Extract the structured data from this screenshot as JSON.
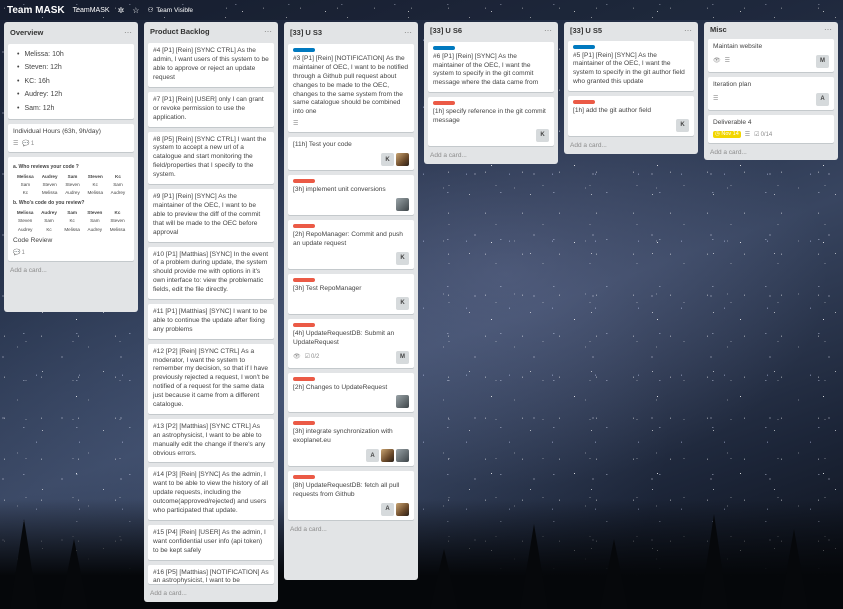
{
  "header": {
    "board_title": "Team MASK",
    "org_name": "TeamMASK",
    "visibility_label": "Team Visible",
    "star_icon": "star-icon",
    "org_icon": "org-gear-icon",
    "visibility_icon": "team-icon"
  },
  "colors": {
    "label_blue": "#0079bf",
    "label_red": "#eb5a46",
    "due_yellow": "#f2d600",
    "list_bg": "#e2e4e6"
  },
  "add_card_label": "Add a card...",
  "lists": {
    "overview": {
      "title": "Overview",
      "bullets": [
        "Melissa: 10h",
        "Steven: 12h",
        "KC: 16h",
        "Audrey: 12h",
        "Sam: 12h"
      ],
      "hours_card": {
        "title": "Individual Hours (63h, 9h/day)",
        "comments": "1"
      },
      "review_title": "a. Who reviews your code ?",
      "review_rows": [
        [
          "Melissa",
          "Audrey",
          "Sam",
          "Steven",
          "Kc"
        ],
        [
          "Sam",
          "Steven",
          "Steven",
          "Kc",
          "Sam"
        ],
        [
          "Kc",
          "Melissa",
          "Audrey",
          "Melissa",
          "Audrey"
        ]
      ],
      "who_review_title": "b. Who's code do you review?",
      "who_rows": [
        [
          "Melissa",
          "Audrey",
          "Sam",
          "Steven",
          "Kc"
        ],
        [
          "Steven",
          "Sam",
          "Kc",
          "Sam",
          "Steven"
        ],
        [
          "Audrey",
          "Kc",
          "Melissa",
          "Audrey",
          "Melissa"
        ]
      ],
      "code_review": {
        "title": "Code Review",
        "comments": "1"
      }
    },
    "backlog": {
      "title": "Product Backlog",
      "cards": [
        "#4 [P1] [Rein] [SYNC CTRL] As the admin, I want users of this system to be able to approve or reject an update request",
        "#7 [P1] [Rein] [USER] only I can grant or revoke permission to use the application.",
        "#8 [P5] [Rein] [SYNC CTRL] I want the system to accept a new url of a catalogue and start monitoring the field/properties that I specify to the system.",
        "#9 [P1] [Rein] [SYNC] As the maintainer of the OEC, I want to be able to preview the diff of the commit that will be made to the OEC before approval",
        "#10 [P1] [Matthias] [SYNC] In the event of a problem during update, the system should provide me with options in it's own interface to: view the problematic fields, edit the file directly.",
        "#11 [P1] [Matthias] [SYNC] I want to be able to continue the update after fixing any problems",
        "#12 [P2] [Rein] [SYNC CTRL] As a moderator, I want the system to remember my decision, so that if I have previously rejected a request, I won't be notified of a request for the same data just because it came from a different catalogue.",
        "#13 [P2] [Matthias] [SYNC CTRL] As an astrophysicist, I want to be able to manually edit the change if there's any obvious errors.",
        "#14 [P3] [Rein] [SYNC] As the admin, I want to be able to view the history of all update requests, including the outcome(approved/rejected) and users who participated that update.",
        "#15 [P4] [Rein] [USER] As the admin, I want confidential user info (api token) to be kept safely",
        "#16 [P5] [Matthias] [NOTIFICATION] As an astrophysicist, I want to be"
      ]
    },
    "us3": {
      "title": "[33] U S3",
      "cards": [
        {
          "label": "blue",
          "text": "#3 [P1] [Rein] [NOTIFICATION] As the maintainer of OEC, I want to be notified through a Github pull request about changes to be made to the OEC, changes to the same system from the same catalogue should be combined into one",
          "desc": true,
          "members": []
        },
        {
          "label": "",
          "text": "[11h] Test your code",
          "members": [
            "K",
            "photo"
          ]
        },
        {
          "label": "red",
          "text": "[3h] implement unit conversions",
          "members": [
            "animal"
          ]
        },
        {
          "label": "red",
          "text": "[2h] RepoManager: Commit and push an update request",
          "members": [
            "K"
          ]
        },
        {
          "label": "red",
          "text": "[3h] Test RepoManager",
          "members": [
            "K"
          ]
        },
        {
          "label": "red",
          "text": "[4h] UpdateRequestDB: Submit an UpdateRequest",
          "watch": true,
          "checklist": "0/2",
          "members": [
            "M"
          ]
        },
        {
          "label": "red",
          "text": "[2h] Changes to UpdateRequest",
          "members": [
            "animal"
          ]
        },
        {
          "label": "red",
          "text": "[3h] integrate synchronization with exoplanet.eu",
          "members": [
            "A",
            "photo",
            "animal"
          ]
        },
        {
          "label": "red",
          "text": "[8h] UpdateRequestDB: fetch all pull requests from Github",
          "members": [
            "A",
            "photo"
          ]
        }
      ]
    },
    "us6": {
      "title": "[33] U S6",
      "cards": [
        {
          "label": "blue",
          "text": "#6 [P1] [Rein] [SYNC] As the maintainer of the OEC, I want the system to specify in the git commit message where the data came from",
          "members": []
        },
        {
          "label": "red",
          "text": "[1h] specify reference in the git commit message",
          "members": [
            "K"
          ]
        }
      ]
    },
    "us5": {
      "title": "[33] U S5",
      "cards": [
        {
          "label": "blue",
          "text": "#5 [P1] [Rein] [SYNC] As the maintainer of the OEC, I want the system to specify in the git author field who granted this update",
          "members": []
        },
        {
          "label": "red",
          "text": "[1h] add the git author field",
          "members": [
            "K"
          ]
        }
      ]
    },
    "misc": {
      "title": "Misc",
      "cards": [
        {
          "text": "Maintain website",
          "watch": true,
          "desc": true,
          "members": [
            "M"
          ]
        },
        {
          "text": "Iteration plan",
          "desc": true,
          "members": [
            "A"
          ]
        },
        {
          "text": "Deliverable 4",
          "due": "Nov 14",
          "desc": true,
          "checklist": "0/14",
          "members": []
        }
      ]
    }
  }
}
